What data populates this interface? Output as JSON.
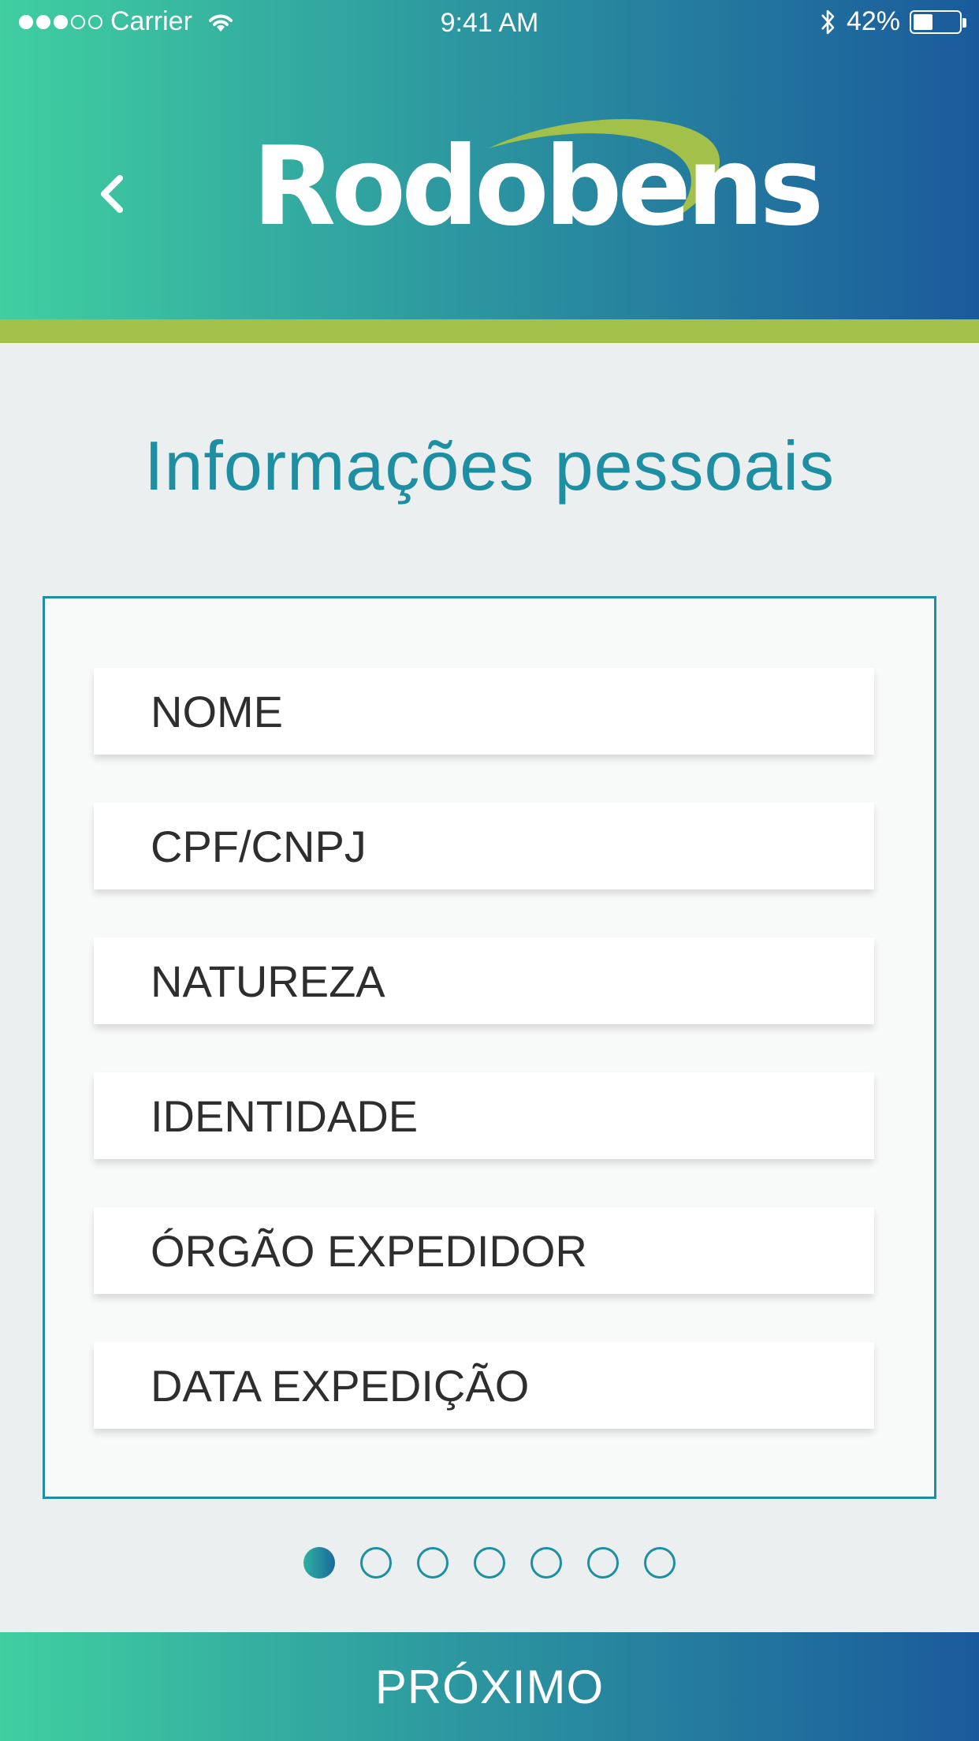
{
  "status_bar": {
    "carrier": "Carrier",
    "time": "9:41 AM",
    "battery": "42%",
    "signal_strength": 3,
    "signal_max": 5,
    "battery_level": 0.42
  },
  "header": {
    "brand": "Rodobens",
    "back_icon": "chevron-left-icon"
  },
  "main": {
    "title": "Informações pessoais",
    "fields": [
      {
        "label": "NOME"
      },
      {
        "label": "CPF/CNPJ"
      },
      {
        "label": "NATUREZA"
      },
      {
        "label": "IDENTIDADE"
      },
      {
        "label": "ÓRGÃO EXPEDIDOR"
      },
      {
        "label": "DATA EXPEDIÇÃO"
      }
    ]
  },
  "pagination": {
    "total": 7,
    "current": 1
  },
  "footer": {
    "next_label": "PRÓXIMO"
  },
  "colors": {
    "accent": "#1E8EA2",
    "gradient_start": "#40CFA0",
    "gradient_end": "#1A5A9C",
    "band_green": "#A2C04A",
    "background": "#ECEFF0"
  }
}
